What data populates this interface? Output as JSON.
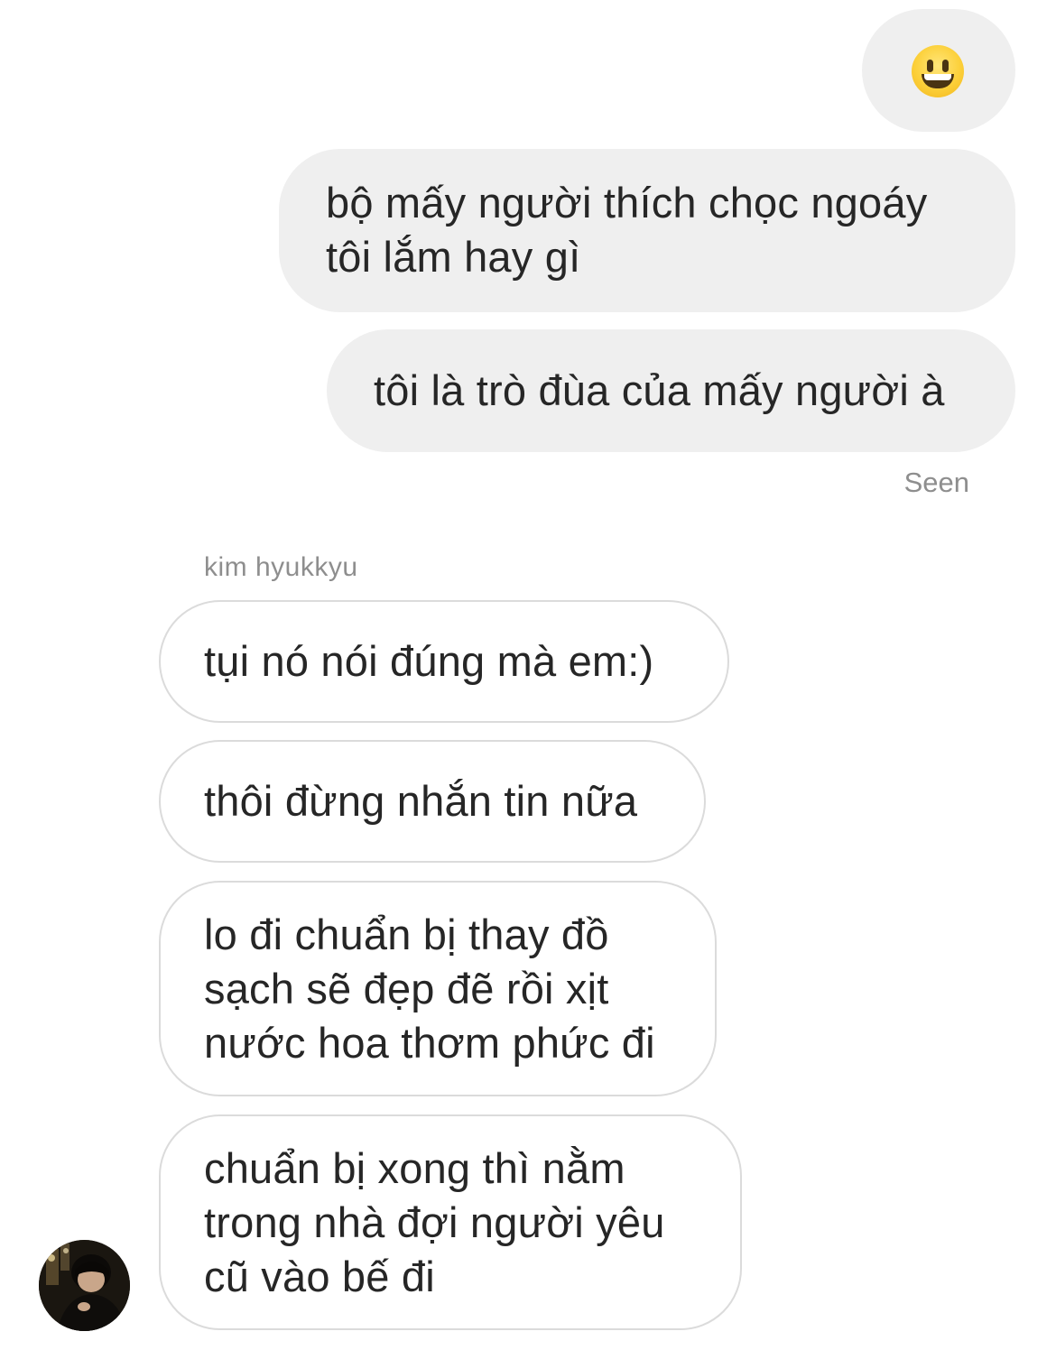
{
  "conversation": {
    "outgoing": [
      {
        "type": "emoji",
        "icon": "grinning-face-emoji"
      },
      {
        "type": "text",
        "text": "bộ mấy người thích chọc ngoáy\ntôi lắm hay gì"
      },
      {
        "type": "text",
        "text": "tôi là trò đùa của mấy người à"
      }
    ],
    "status": "Seen",
    "sender_name": "kim hyukkyu",
    "incoming": [
      {
        "text": "tụi nó nói đúng mà em:)"
      },
      {
        "text": "thôi đừng nhắn tin nữa"
      },
      {
        "text": "lo đi chuẩn bị thay đồ\nsạch sẽ đẹp đẽ rồi xịt\nnước hoa thơm phức đi"
      },
      {
        "text": "chuẩn bị xong thì nằm\ntrong nhà đợi người yêu\ncũ vào bế đi"
      }
    ]
  },
  "colors": {
    "outgoing_bubble": "#efefef",
    "incoming_border": "#dbdbdb",
    "meta_text": "#8e8e8e",
    "message_text": "#262626"
  }
}
